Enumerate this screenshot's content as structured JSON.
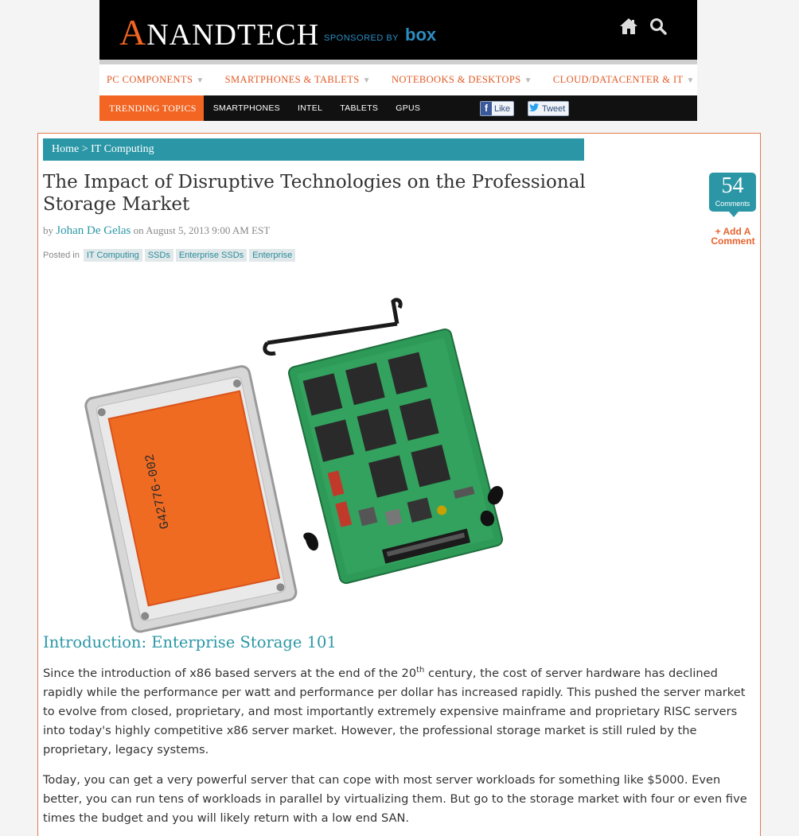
{
  "header": {
    "logo_text": "ANANDTECH",
    "logo_first": "A",
    "logo_rest": "NANDTECH",
    "sponsored_label": "SPONSORED BY",
    "sponsor_name": "box",
    "icons": [
      "home-icon",
      "search-icon"
    ]
  },
  "category_nav": {
    "items": [
      {
        "label": "PC COMPONENTS",
        "caret": "▼"
      },
      {
        "label": "SMARTPHONES & TABLETS",
        "caret": "▼"
      },
      {
        "label": "NOTEBOOKS & DESKTOPS",
        "caret": "▼"
      },
      {
        "label": "CLOUD/DATACENTER & IT",
        "caret": "▼"
      }
    ]
  },
  "trending": {
    "label": "TRENDING TOPICS",
    "links": [
      "SMARTPHONES",
      "INTEL",
      "TABLETS",
      "GPUS"
    ],
    "facebook_label": "Like",
    "twitter_label": "Tweet"
  },
  "breadcrumb": {
    "home": "Home",
    "separator": ">",
    "current": "IT Computing"
  },
  "article": {
    "title": "The Impact of Disruptive Technologies on the Professional Storage Market",
    "by": "by",
    "author": "Johan De Gelas",
    "date": "on August 5, 2013 9:00 AM EST",
    "posted_in": "Posted in",
    "tags": [
      "IT Computing",
      "SSDs",
      "Enterprise SSDs",
      "Enterprise"
    ],
    "image_label": "G42776-002",
    "section_title": "Introduction: Enterprise Storage 101",
    "p1_start": "Since the introduction of x86 based servers at the end of the 20",
    "p1_sup": "th",
    "p1_end": " century, the cost of server hardware has declined rapidly while the performance per watt and performance per dollar has increased rapidly. This pushed the server market to evolve from closed, proprietary, and most importantly extremely expensive mainframe and proprietary RISC servers into today's highly competitive x86 server market. However, the professional storage market is still ruled by the proprietary, legacy systems.",
    "p2": "Today, you can get a very powerful server that can cope with most server workloads for something like $5000. Even better, you can run tens of workloads in parallel by virtualizing them. But go to the storage market with four or even five times the budget and you will likely return with a low end SAN."
  },
  "comments": {
    "count": "54",
    "label": "Comments",
    "add_label": "+ Add A Comment"
  },
  "colors": {
    "accent_orange": "#f26522",
    "teal": "#2b97a6",
    "header_bg": "#000000"
  }
}
